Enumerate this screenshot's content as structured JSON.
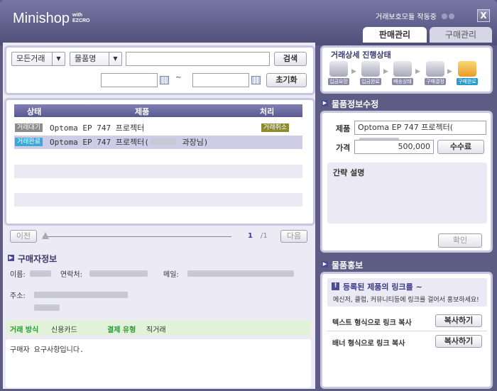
{
  "app": {
    "logo": "Minishop",
    "logo_with": "with",
    "logo_brand": "EZCRO",
    "protection_status": "거래보호모듈 작동중",
    "close": "X"
  },
  "tabs": [
    {
      "label": "판매관리",
      "active": true
    },
    {
      "label": "구매관리",
      "active": false
    }
  ],
  "filter": {
    "trade_select": "모든거래",
    "field_select": "물품명",
    "search_value": "",
    "search_button": "검색",
    "date_from": "",
    "date_to": "",
    "tilde": "~",
    "reset_button": "초기화"
  },
  "table": {
    "headers": [
      "상태",
      "제품",
      "처리"
    ],
    "rows": [
      {
        "status": "거래대기",
        "status_color": "#8c8c8c",
        "product": "Optoma EP 747 프로젝터",
        "action": "거래취소"
      },
      {
        "status": "거래완료",
        "status_color": "#3aa8d8",
        "product": "Optoma EP 747 프로젝터(",
        "product_suffix": " 과장님)",
        "action": ""
      }
    ]
  },
  "pager": {
    "prev": "이전",
    "next": "다음",
    "current": "1",
    "total": "/1"
  },
  "buyer": {
    "title": "구매자정보",
    "name_label": "이름:",
    "contact_label": "연락처:",
    "email_label": "메일:",
    "address_label": "주소:",
    "payment_method_label": "거래 방식",
    "payment_method": "신용카드",
    "payment_type_label": "결제 유형",
    "payment_type": "직거래",
    "request": "구매자 요구사항입니다."
  },
  "progress": {
    "title": "거래상세 진행상태",
    "steps": [
      {
        "label": "입금요망",
        "active": false
      },
      {
        "label": "입금완료",
        "active": false
      },
      {
        "label": "배송상태",
        "active": false
      },
      {
        "label": "구매결정",
        "active": false
      },
      {
        "label": "구매완료",
        "active": true
      }
    ]
  },
  "edit": {
    "title": "물품정보수정",
    "product_label": "제품",
    "product_value": "Optoma EP 747 프로젝터(",
    "price_label": "가격",
    "price_value": "500,000",
    "fee_button": "수수료",
    "desc_label": "간략 설명",
    "confirm_button": "확인"
  },
  "promo": {
    "title": "물품홍보",
    "notice_title": "등록된 제품의 링크를 ~",
    "notice_text": "메신저, 클럽, 커뮤니티등에 링크를 걸어서 홍보하세요!",
    "text_link_label": "텍스트 형식으로 링크 복사",
    "text_link_button": "복사하기",
    "banner_link_label": "배너 형식으로 링크 복사",
    "banner_link_button": "복사하기"
  },
  "colors": {
    "accent": "#5a5a92",
    "window": "#5c5c84",
    "green_label": "#2a9a3a"
  }
}
